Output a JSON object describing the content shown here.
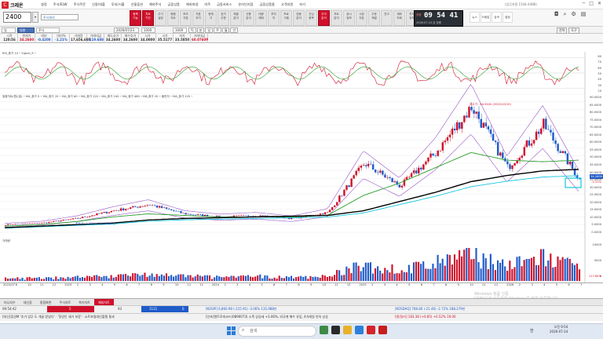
{
  "app": {
    "logo": "크레온",
    "right_note": "(업무지원 1544-4488)"
  },
  "menu": [
    "설정",
    "주식/ELW",
    "주식주문",
    "신용/대출",
    "투자/시황",
    "선물옵션",
    "해외주식",
    "금융상품",
    "해외파생",
    "미주",
    "금융서비스",
    "온라인지점",
    "금융상품몰",
    "고객지원",
    "보기"
  ],
  "stock": {
    "code": "2400",
    "name": "주식회의",
    "code_type": "주식"
  },
  "toolbar_buttons": [
    {
      "label": "종목\n기능",
      "red": true
    },
    {
      "label": "차트\n기간",
      "red": true
    },
    {
      "label": "주기\n설정",
      "red": false
    },
    {
      "label": "종합\n차트",
      "red": false
    },
    {
      "label": "보조\n지표",
      "red": false
    },
    {
      "label": "지표\n추가",
      "red": false
    },
    {
      "label": "현재\n가",
      "red": false
    },
    {
      "label": "호가\n주문",
      "red": false
    },
    {
      "label": "체결\n분석",
      "red": false
    },
    {
      "label": "신용\n분석",
      "red": false
    },
    {
      "label": "대량\n매매",
      "red": false
    },
    {
      "label": "투자\n자",
      "red": false
    },
    {
      "label": "프로\n그램",
      "red": false
    },
    {
      "label": "업종\n분석",
      "red": false
    },
    {
      "label": "관심\n종목",
      "red": false
    },
    {
      "label": "주가\n분석",
      "red": true
    },
    {
      "label": "차트\n분석",
      "red": false
    },
    {
      "label": "공시\n정보",
      "red": false
    },
    {
      "label": "시장\n지표",
      "red": false
    },
    {
      "label": "주문\n체결",
      "red": false
    },
    {
      "label": "잔고",
      "red": false
    },
    {
      "label": "계좌\n조회",
      "red": false
    },
    {
      "label": "투자\n정보",
      "red": false
    },
    {
      "label": "예약\n주문",
      "red": false
    },
    {
      "label": "자동\n주문",
      "red": true
    }
  ],
  "clock": {
    "time": "09 54 41",
    "label": "장중",
    "date": "2026.07.24 금  장중"
  },
  "right_icons": [
    "뉴스",
    "도움말",
    "검색",
    "알림"
  ],
  "row3": {
    "mode": "일",
    "period": "2026/07/23",
    "count": "1000",
    "unit": "1000",
    "tab_active": "일봉",
    "tabs": [
      "틱",
      "분",
      "일",
      "주",
      "월",
      "년"
    ],
    "buttons": [
      "전략",
      "도구"
    ]
  },
  "quote": {
    "headers": [
      "시작",
      "현재가",
      "대비",
      "대비%",
      "거래량",
      "거래대금",
      "매도호가",
      "매수호가",
      "시가",
      "고가",
      "저가",
      "거래대금"
    ],
    "values": [
      "120:56",
      "34.2600",
      "-0.4200",
      "-1.21%",
      "17,656,605",
      "-119.688",
      "34.2600",
      "34.2600",
      "34.0000",
      "35.5177",
      "33.5850",
      "60.0760P"
    ]
  },
  "indicator": {
    "legend": "RSI_종가 14 ─ Signal_9 ─",
    "scale": [
      "80",
      "70",
      "60",
      "50",
      "40",
      "30",
      "20"
    ]
  },
  "main_chart": {
    "legend": "일봉차트(원)(일) ─ MA_종가 5 ─ MA_종가 20 ─ MA_종가 60 ─ MA_종가 120 ─ MA_종가 240 ─ MA_종가 480 ─ BB_종가 20 ─ 볼린저 ─ MA_종가 120 ─",
    "scale": [
      "90.0000",
      "85.0000",
      "80.0000",
      "75.0000",
      "70.0000",
      "65.0000",
      "60.0000",
      "55.0000",
      "50.0000",
      "45.0000",
      "40.0000",
      "35.0000",
      "30.0000",
      "25.0000",
      "20.0000",
      "15.0000",
      "10.0000",
      "5.0000",
      "0.0000"
    ],
    "high_note": "최고가 : 84.9400 (2025/10/15)",
    "low_note": "최저가 : 2.3200 (2022/08/11)",
    "last_price": "34.2600",
    "pct_note": "-1.21%"
  },
  "volume": {
    "legend": "거래량",
    "scale": [
      "10000",
      "5000",
      "0"
    ],
    "pct_note": "117.84%"
  },
  "dates": [
    "2022/07",
    "8",
    "10",
    "11",
    "12",
    "2023",
    "2",
    "3",
    "4",
    "5",
    "6",
    "7",
    "8",
    "9",
    "10",
    "11",
    "12",
    "2024",
    "2",
    "3",
    "4",
    "5",
    "6",
    "7",
    "8",
    "9",
    "10",
    "11",
    "12",
    "2025",
    "2",
    "3",
    "4",
    "5",
    "6",
    "7",
    "8",
    "9",
    "10",
    "11",
    "12",
    "2026",
    "2",
    "3",
    "4",
    "5",
    "6",
    "7"
  ],
  "bottom_tabs": [
    "미니지수",
    "대신증",
    "종합화면",
    "주식차트",
    "복기차트",
    "해외차트"
  ],
  "ticker1": {
    "left": "09:54:42",
    "kospi": "[KOSPI] 6,860.98 (-215.91) -3.06%  135,988만",
    "kosdaq": "[KOSDAQ]  768.80 (-21.46) -2.72%  188,279만",
    "b1": "93",
    "b2": "1111",
    "b3": "0",
    "b4": "5"
  },
  "ticker2": {
    "left": "[대신]증권M '추가 업무 도 개굴 받았다' · '정양인 세가 보장' · 쇼트포털대인볼렘 통과",
    "mid": "[인포]엔트로피코드(0890073) 소폭 상승세 +3.06%, 외국계 매수 유입, 4거래일 연속 상승",
    "right": "[엔/달러] 183.38 (+0.85) +0.52%  16:00"
  },
  "watermark": "Windows 정품 인증\n[설정]으로 이동하여 Windows를 정품 인증합니다.",
  "taskbar": {
    "search": "검색",
    "time": "오전 9:54",
    "date": "2026-07-24",
    "lang": "한"
  },
  "colors": {
    "rise": "#d0102a",
    "fall": "#1f5bc9",
    "ma_long": "#000000",
    "ma_mid": "#2a9c2a",
    "bb": "#9a58c8",
    "support": "#16c7e0"
  },
  "chart_data": {
    "type": "line",
    "title": "",
    "xlabel": "",
    "ylabel": "",
    "ylim": [
      0,
      90
    ],
    "x": [
      "2022/07",
      "2022/10",
      "2023/01",
      "2023/04",
      "2023/07",
      "2023/10",
      "2024/01",
      "2024/04",
      "2024/07",
      "2024/10",
      "2025/01",
      "2025/04",
      "2025/07",
      "2025/10",
      "2026/01",
      "2026/04",
      "2026/07"
    ],
    "series": [
      {
        "name": "종가",
        "values": [
          5,
          6,
          9,
          14,
          18,
          12,
          10,
          11,
          9,
          13,
          45,
          30,
          52,
          82,
          42,
          70,
          34.26
        ]
      },
      {
        "name": "MA_종가 120",
        "values": [
          4,
          5,
          7,
          10,
          12,
          11,
          10,
          10,
          10,
          11,
          24,
          32,
          42,
          52,
          47,
          46,
          47
        ]
      },
      {
        "name": "MA_종가 480",
        "values": [
          3,
          4,
          5,
          6,
          8,
          9,
          9.5,
          10,
          10.5,
          11,
          14,
          20,
          26,
          33,
          37,
          40,
          41
        ]
      }
    ]
  }
}
